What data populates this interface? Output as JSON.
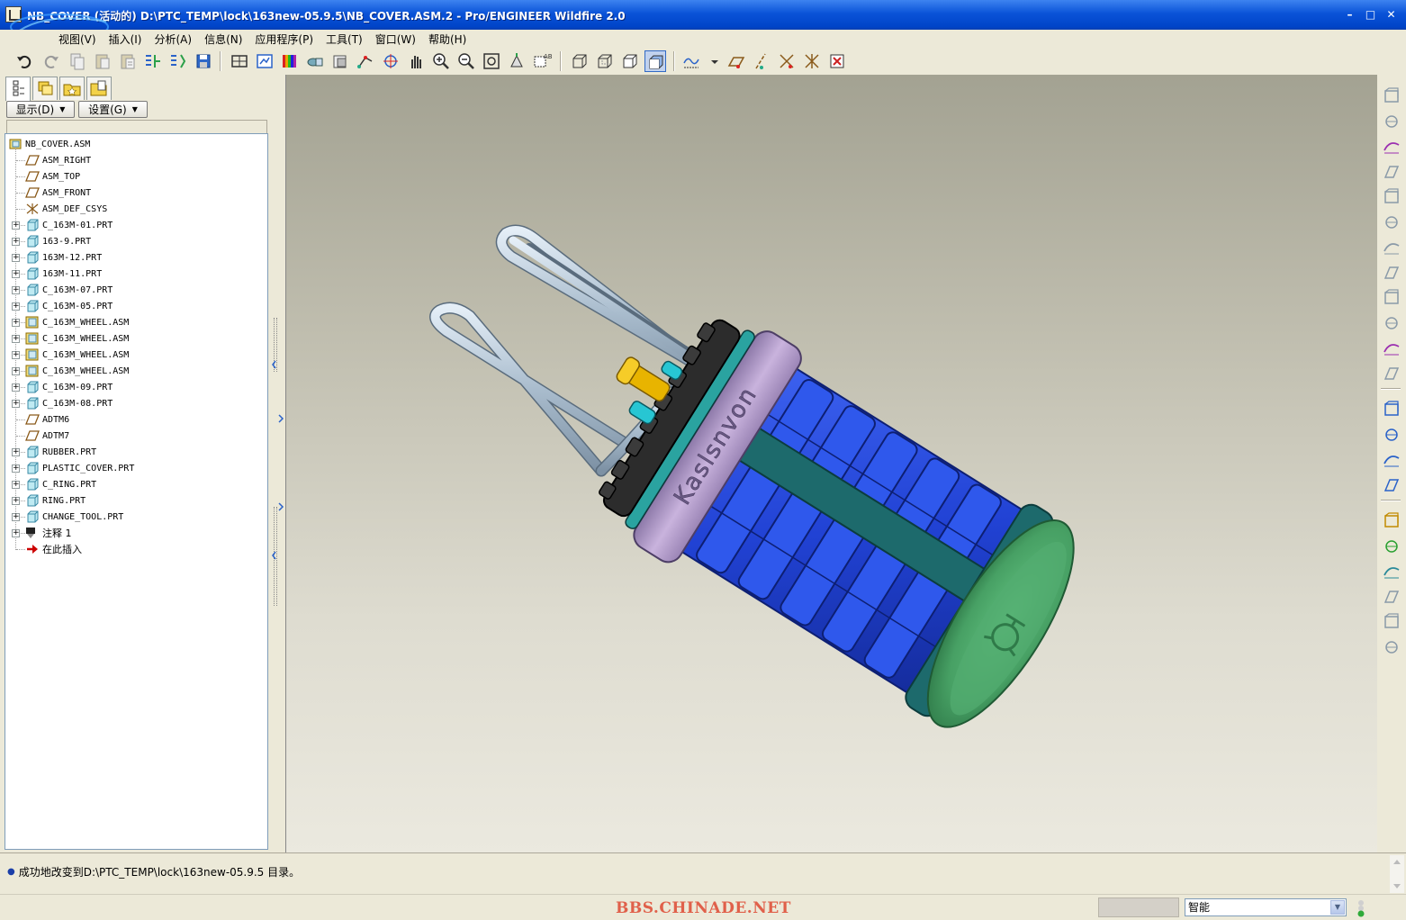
{
  "window": {
    "title": "NB_COVER (活动的) D:\\PTC_TEMP\\lock\\163new-05.9.5\\NB_COVER.ASM.2 - Pro/ENGINEER Wildfire 2.0",
    "controls": [
      "minimize",
      "maximize",
      "close"
    ]
  },
  "menu": {
    "items": [
      {
        "label": "视图(V)"
      },
      {
        "label": "插入(I)"
      },
      {
        "label": "分析(A)"
      },
      {
        "label": "信息(N)"
      },
      {
        "label": "应用程序(P)"
      },
      {
        "label": "工具(T)"
      },
      {
        "label": "窗口(W)"
      },
      {
        "label": "帮助(H)"
      }
    ]
  },
  "navigator": {
    "tabs": [
      "model-tree-icon",
      "layers-icon",
      "favorites-icon",
      "folder-browser-icon"
    ],
    "show_label": "显示(D)",
    "settings_label": "设置(G)"
  },
  "model_tree": {
    "root": "NB_COVER.ASM",
    "items": [
      {
        "label": "ASM_RIGHT",
        "type": "datum-plane",
        "expandable": false
      },
      {
        "label": "ASM_TOP",
        "type": "datum-plane",
        "expandable": false
      },
      {
        "label": "ASM_FRONT",
        "type": "datum-plane",
        "expandable": false
      },
      {
        "label": "ASM_DEF_CSYS",
        "type": "csys",
        "expandable": false
      },
      {
        "label": "C_163M-01.PRT",
        "type": "part",
        "expandable": true
      },
      {
        "label": "163-9.PRT",
        "type": "part",
        "expandable": true
      },
      {
        "label": "163M-12.PRT",
        "type": "part",
        "expandable": true
      },
      {
        "label": "163M-11.PRT",
        "type": "part",
        "expandable": true
      },
      {
        "label": "C_163M-07.PRT",
        "type": "part",
        "expandable": true
      },
      {
        "label": "C_163M-05.PRT",
        "type": "part",
        "expandable": true
      },
      {
        "label": "C_163M_WHEEL.ASM",
        "type": "assembly",
        "expandable": true
      },
      {
        "label": "C_163M_WHEEL.ASM",
        "type": "assembly",
        "expandable": true
      },
      {
        "label": "C_163M_WHEEL.ASM",
        "type": "assembly",
        "expandable": true
      },
      {
        "label": "C_163M_WHEEL.ASM",
        "type": "assembly",
        "expandable": true
      },
      {
        "label": "C_163M-09.PRT",
        "type": "part",
        "expandable": true
      },
      {
        "label": "C_163M-08.PRT",
        "type": "part",
        "expandable": true
      },
      {
        "label": "ADTM6",
        "type": "datum-plane",
        "expandable": false
      },
      {
        "label": "ADTM7",
        "type": "datum-plane",
        "expandable": false
      },
      {
        "label": "RUBBER.PRT",
        "type": "part",
        "expandable": true
      },
      {
        "label": "PLASTIC_COVER.PRT",
        "type": "part",
        "expandable": true
      },
      {
        "label": "C_RING.PRT",
        "type": "part",
        "expandable": true
      },
      {
        "label": "RING.PRT",
        "type": "part",
        "expandable": true
      },
      {
        "label": "CHANGE_TOOL.PRT",
        "type": "part",
        "expandable": true
      },
      {
        "label": "注释 1",
        "type": "note",
        "expandable": true
      },
      {
        "label": "在此插入",
        "type": "insert-here",
        "expandable": false
      }
    ]
  },
  "model_view": {
    "engraved_text": "Kaslsnvon"
  },
  "message_area": {
    "message": "成功地改变到D:\\PTC_TEMP\\lock\\163new-05.9.5 目录。"
  },
  "status_bar": {
    "watermark": "BBS.CHINADE.NET",
    "filter_value": "智能"
  },
  "colors": {
    "titlebar": "#0a53d8",
    "viewport_top": "#a3a292",
    "viewport_bottom": "#ebe9df",
    "cap_green": "#4fa36a",
    "body_blue": "#2448d8",
    "ring_lavender": "#b19ac8",
    "teal": "#1f6b6e"
  }
}
